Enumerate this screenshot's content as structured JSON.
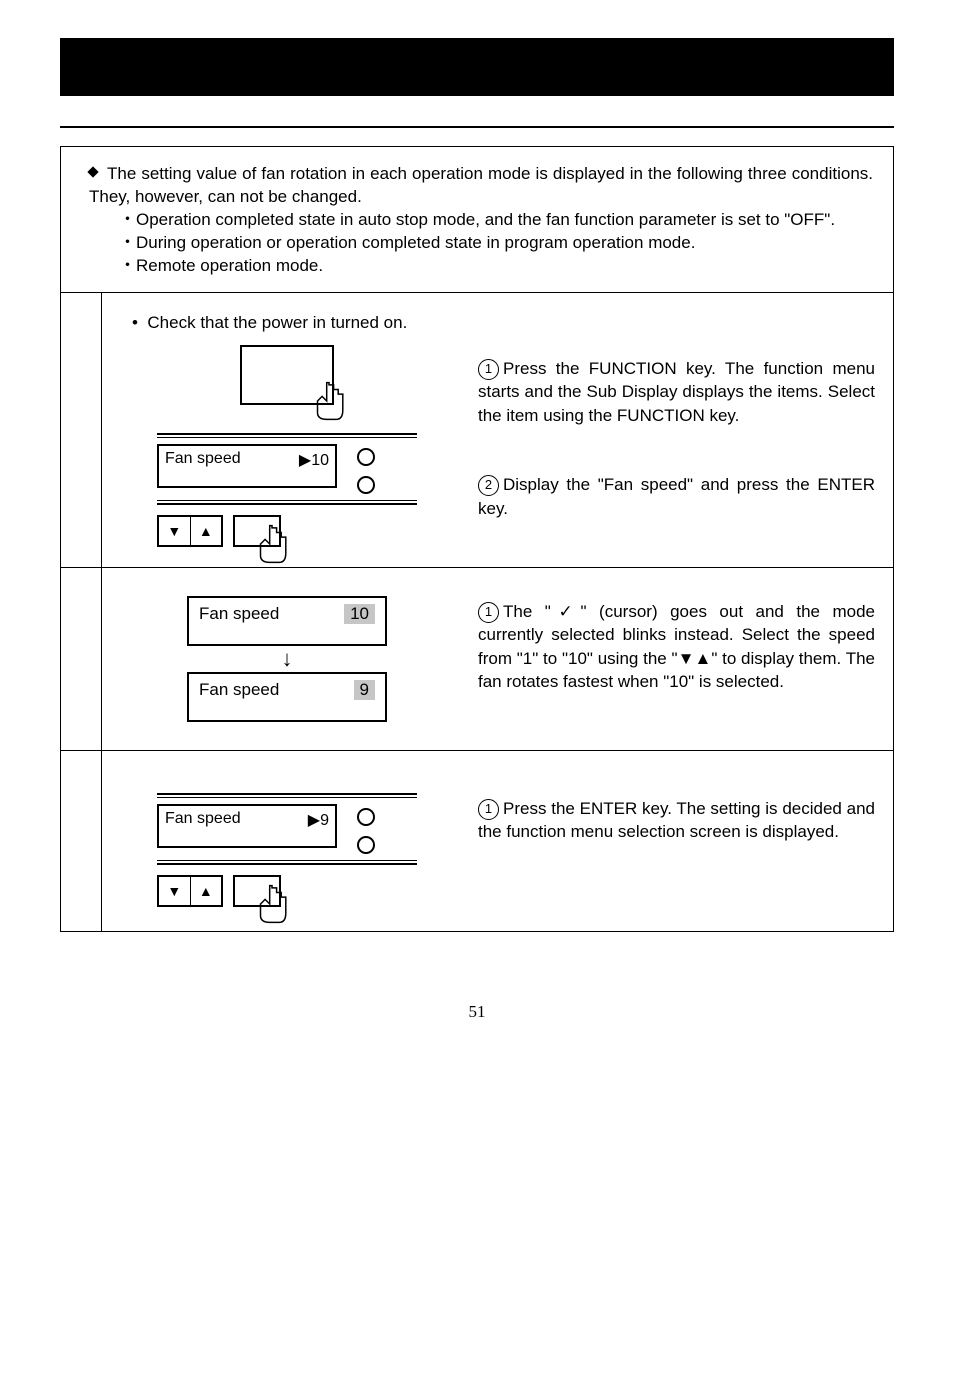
{
  "intro": {
    "lead": "The setting value of fan rotation in each operation mode is displayed in the following three conditions.  They, however, can not be changed.",
    "b1": "・Operation completed state in auto stop mode, and the fan function parameter is set to \"OFF\".",
    "b2": "・During operation or operation completed state in program operation mode.",
    "b3": "・Remote operation mode."
  },
  "step1": {
    "check": "Check that the power in turned on.",
    "r1": "Press  the  FUNCTION  key.    The  function  menu  starts  and  the  Sub  Display  displays  the  items.  Select the item using the FUNCTION key.",
    "r2": "Display  the  \"Fan  speed\"  and  press  the  ENTER  key.",
    "lcd_label": "Fan speed",
    "lcd_val": "▶10"
  },
  "step2": {
    "r1": "The \"✓\" (cursor) goes out and the mode currently  selected  blinks  instead.    Select  the  speed  from  \"1\" to \"10\" using the \"▼▲\" to display them.    The  fan rotates fastest when \"10\" is selected.",
    "b1_label": "Fan speed",
    "b1_val": "10",
    "b2_label": "Fan speed",
    "b2_val": "9"
  },
  "step3": {
    "r1": "Press  the  ENTER  key.    The  setting  is  decided  and  the  function  menu  selection  screen  is  displayed.",
    "lcd_label": "Fan speed",
    "lcd_val": "▶9"
  },
  "circ": {
    "n1": "1",
    "n2": "2"
  },
  "icons": {
    "down": "▼",
    "up": "▲",
    "darrow": "↓",
    "bullet": "•"
  },
  "page": "51"
}
